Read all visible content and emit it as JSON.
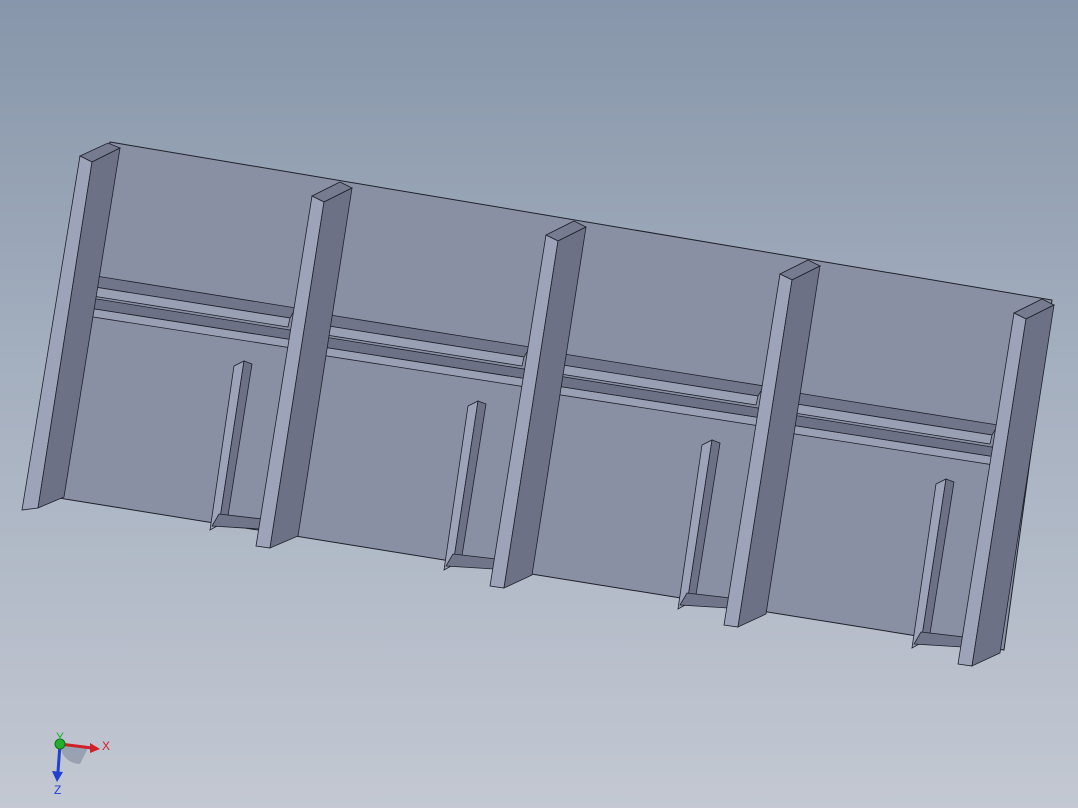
{
  "viewport": {
    "colors": {
      "background_top": "#8796aa",
      "background_bottom": "#c3c8d2",
      "panel_face": "#8a90a4",
      "post_front": "#9da3b8",
      "post_side": "#6c7186",
      "post_top": "#767b8f",
      "shelf_top": "#70758a",
      "shelf_front": "#9aa0b4",
      "edge": "#1e2029"
    },
    "model": {
      "bays": 4,
      "description_icon": "cabinet-frame-model"
    }
  },
  "triad": {
    "x_label": "X",
    "y_label": "Y",
    "z_label": "Z",
    "x_color": "#d0202a",
    "y_color": "#22b02a",
    "z_color": "#2040d0"
  }
}
